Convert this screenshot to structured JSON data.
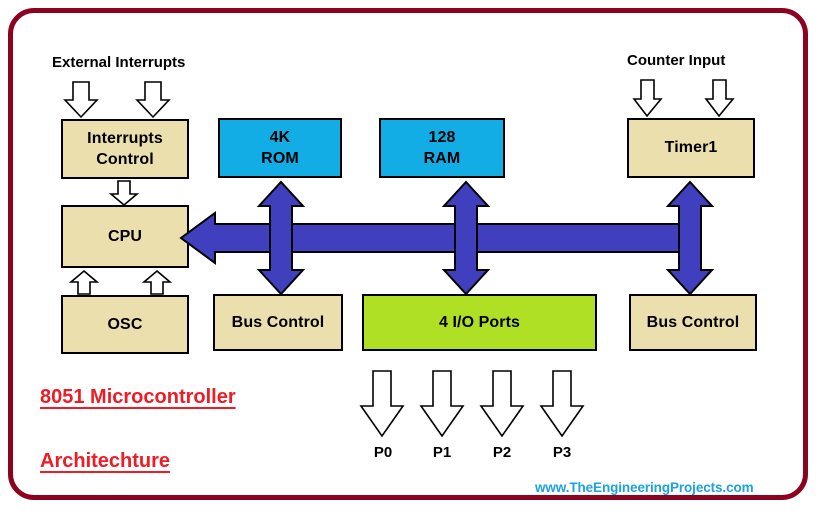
{
  "diagram": {
    "title_lines": [
      "8051 Microcontroller",
      "Architechture"
    ],
    "site_url": "www.TheEngineeringProjects.com",
    "frame_color": "#8c0320",
    "bus_color": "#4040be",
    "title_color": "#ee1c25",
    "url_color": "#1ca3de",
    "captions": [
      {
        "id": "external-interrupts",
        "text": "External Interrupts"
      },
      {
        "id": "counter-input",
        "text": "Counter Input"
      }
    ],
    "blocks": [
      {
        "id": "interrupts-control",
        "lines": [
          "Interrupts",
          "Control"
        ],
        "fill": "#ecdfae"
      },
      {
        "id": "cpu",
        "lines": [
          "CPU"
        ],
        "fill": "#ecdfae"
      },
      {
        "id": "osc",
        "lines": [
          "OSC"
        ],
        "fill": "#ecdfae"
      },
      {
        "id": "rom",
        "lines": [
          "4K",
          "ROM"
        ],
        "fill": "#12ade4"
      },
      {
        "id": "ram",
        "lines": [
          "128",
          "RAM"
        ],
        "fill": "#12ade4"
      },
      {
        "id": "timer1",
        "lines": [
          "Timer1"
        ],
        "fill": "#ecdfae"
      },
      {
        "id": "bus-control-left",
        "lines": [
          "Bus Control"
        ],
        "fill": "#ecdfae"
      },
      {
        "id": "io-ports",
        "lines": [
          "4 I/O Ports"
        ],
        "fill": "#b0e024"
      },
      {
        "id": "bus-control-right",
        "lines": [
          "Bus Control"
        ],
        "fill": "#ecdfae"
      }
    ],
    "ports": [
      {
        "id": "p0",
        "label": "P0"
      },
      {
        "id": "p1",
        "label": "P1"
      },
      {
        "id": "p2",
        "label": "P2"
      },
      {
        "id": "p3",
        "label": "P3"
      }
    ]
  }
}
